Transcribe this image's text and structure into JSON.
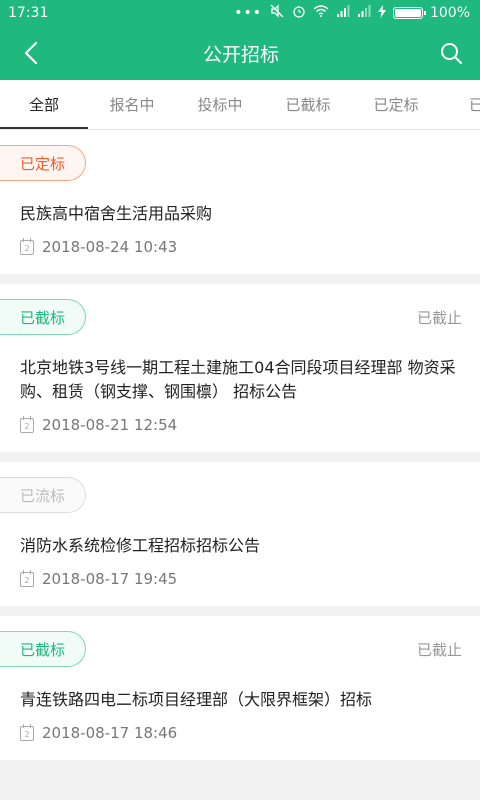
{
  "status_bar": {
    "time": "17:31",
    "dots": "•••",
    "battery_text": "100%",
    "battery_level": 1.0
  },
  "header": {
    "title": "公开招标",
    "back_icon": "back-arrow-icon",
    "search_icon": "search-icon"
  },
  "tabs": [
    {
      "label": "全部",
      "active": true
    },
    {
      "label": "报名中",
      "active": false
    },
    {
      "label": "投标中",
      "active": false
    },
    {
      "label": "已截标",
      "active": false
    },
    {
      "label": "已定标",
      "active": false
    },
    {
      "label": "已启",
      "active": false
    }
  ],
  "items": [
    {
      "badge": "已定标",
      "badge_style": "orange",
      "state": "",
      "title": "民族高中宿舍生活用品采购",
      "date": "2018-08-24 10:43"
    },
    {
      "badge": "已截标",
      "badge_style": "green",
      "state": "已截止",
      "title": "北京地铁3号线一期工程土建施工04合同段项目经理部  物资采购、租赁（钢支撑、钢围檩） 招标公告",
      "date": "2018-08-21 12:54"
    },
    {
      "badge": "已流标",
      "badge_style": "gray",
      "state": "",
      "title": "消防水系统检修工程招标招标公告",
      "date": "2018-08-17 19:45"
    },
    {
      "badge": "已截标",
      "badge_style": "green",
      "state": "已截止",
      "title": "青连铁路四电二标项目经理部（大限界框架）招标",
      "date": "2018-08-17 18:46"
    }
  ],
  "calendar_glyph": "2",
  "colors": {
    "brand": "#1fb87e",
    "badge_orange": "#f25b2a",
    "badge_green": "#1fb87e",
    "badge_gray": "#bbbbbb"
  }
}
